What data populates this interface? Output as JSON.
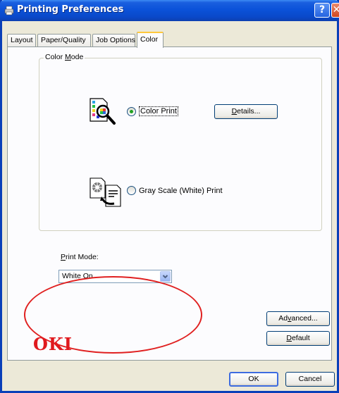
{
  "window": {
    "title": "Printing Preferences",
    "help_label": "?",
    "close_label": "✕"
  },
  "tabs": [
    {
      "label": "Layout",
      "active": false
    },
    {
      "label": "Paper/Quality",
      "active": false
    },
    {
      "label": "Job Options",
      "active": false
    },
    {
      "label": "Color",
      "active": true
    }
  ],
  "color_mode": {
    "group_label_pre": "Color ",
    "group_label_u": "M",
    "group_label_post": "ode",
    "option_color": {
      "label": "Color Print",
      "checked": true
    },
    "option_gray": {
      "label": "Gray Scale (White) Print",
      "checked": false
    },
    "details_button": {
      "u": "D",
      "rest": "etails..."
    }
  },
  "print_mode": {
    "label_u": "P",
    "label_rest": "rint Mode:",
    "selected_value": "White On"
  },
  "buttons": {
    "advanced": {
      "pre": "Ad",
      "u": "v",
      "post": "anced..."
    },
    "default": {
      "u": "D",
      "rest": "efault"
    },
    "ok": "OK",
    "cancel": "Cancel"
  },
  "brand": {
    "logo_text": "OKI",
    "color": "#e0191e"
  },
  "icons": {
    "title": "printer-icon",
    "color_print": "color-document-magnifier-icon",
    "gray_print": "grayscale-document-icon",
    "dropdown": "chevron-down-icon"
  }
}
